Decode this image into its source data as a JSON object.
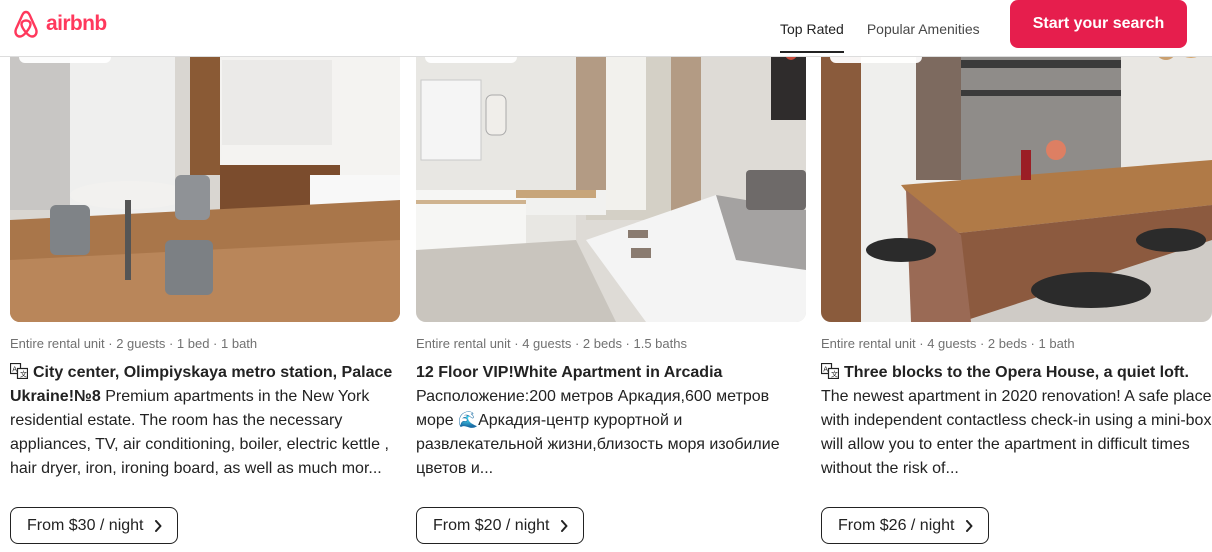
{
  "header": {
    "logo_text": "airbnb",
    "brand_color": "#ff385c",
    "tabs": [
      {
        "label": "Top Rated",
        "active": true
      },
      {
        "label": "Popular Amenities",
        "active": false
      }
    ],
    "cta_label": "Start your search",
    "cta_color": "#e61e4d"
  },
  "listings": [
    {
      "meta": "Entire rental unit · 2 guests · 1 bed · 1 bath",
      "translated": true,
      "title": "City center, Olimpiyskaya metro station, Palace Ukraine!№8",
      "description": "Premium apartments in the New York residential estate. The room has the necessary appliances, TV, air conditioning, boiler, electric kettle , hair dryer, iron, ironing board, as well as much mor...",
      "price_label": "From $30 / night",
      "photo": "bright-studio-kitchen-with-table"
    },
    {
      "meta": "Entire rental unit · 4 guests · 2 beds · 1.5 baths",
      "translated": false,
      "title": "12 Floor VIP!White Apartment in Arcadia",
      "description": "Расположение:200 метров Аркадия,600 метров море 🌊Аркадия-центр курортной и развлекательной жизни,близость моря изобилие цветов и...",
      "price_label": "From $20 / night",
      "photo": "white-bedroom-with-window"
    },
    {
      "meta": "Entire rental unit · 4 guests · 2 beds · 1 bath",
      "translated": true,
      "title": "Three blocks to the Opera House, a quiet loft.",
      "description": "The newest apartment in 2020 renovation! A safe place with independent contactless check-in using a mini-box will allow you to enter the apartment in difficult times without the risk of...",
      "price_label": "From $26 / night",
      "photo": "loft-kitchen-bar-counter"
    }
  ]
}
